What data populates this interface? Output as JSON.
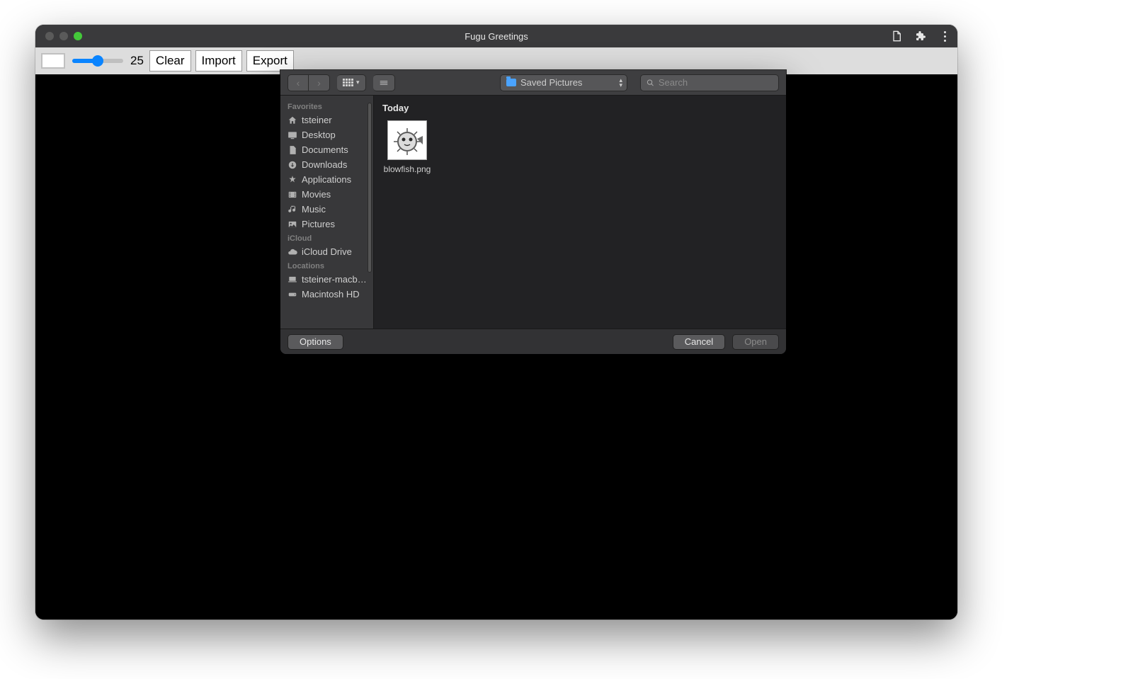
{
  "window": {
    "title": "Fugu Greetings"
  },
  "toolbar": {
    "slider_value": "25",
    "clear_label": "Clear",
    "import_label": "Import",
    "export_label": "Export"
  },
  "dialog": {
    "path_label": "Saved Pictures",
    "search_placeholder": "Search",
    "group_header": "Today",
    "file_name": "blowfish.png",
    "options_label": "Options",
    "cancel_label": "Cancel",
    "open_label": "Open",
    "sidebar": {
      "favorites_section": "Favorites",
      "icloud_section": "iCloud",
      "locations_section": "Locations",
      "items": {
        "home": "tsteiner",
        "desktop": "Desktop",
        "documents": "Documents",
        "downloads": "Downloads",
        "applications": "Applications",
        "movies": "Movies",
        "music": "Music",
        "pictures": "Pictures",
        "icloud_drive": "iCloud Drive",
        "macbook": "tsteiner-macb…",
        "macintosh_hd": "Macintosh HD"
      }
    }
  }
}
